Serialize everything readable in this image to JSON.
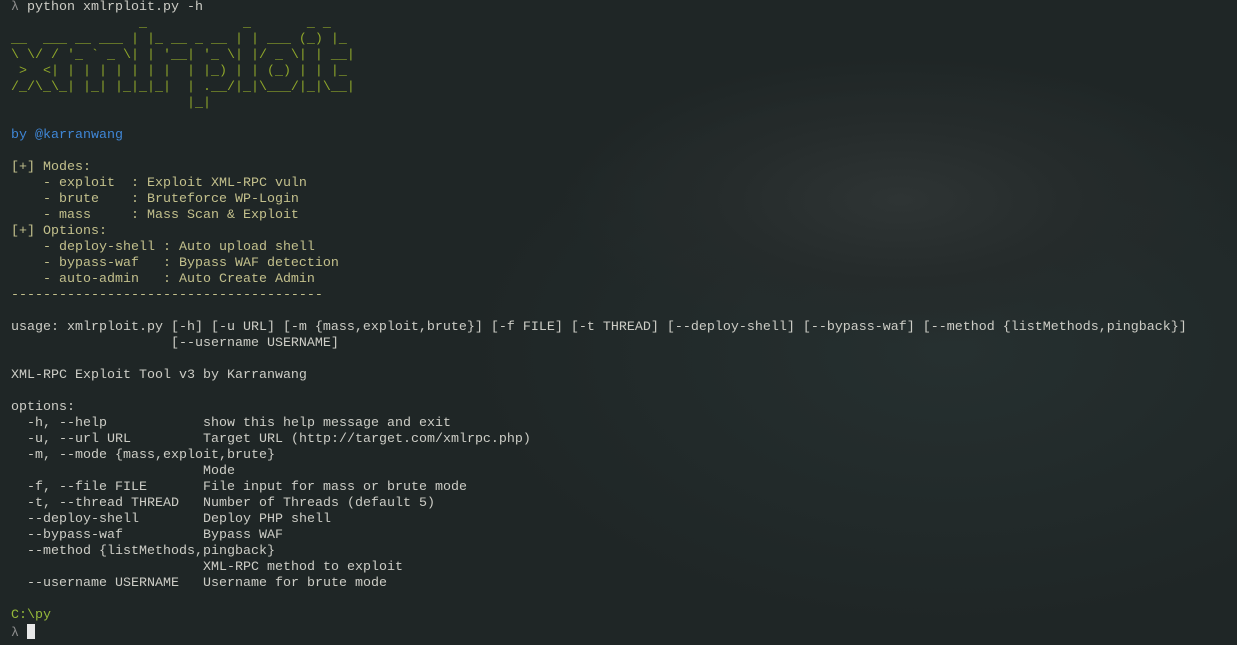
{
  "command": {
    "prompt_symbol": "λ",
    "text": "python xmlrploit.py -h"
  },
  "banner_art": [
    "                _            _       _ _   ",
    "__  ___ __ ___ | |_ __ _ __ | | ___ (_) |_ ",
    "\\ \\/ / '_ ` _ \\| | '__| '_ \\| |/ _ \\| | __|",
    " >  <| | | | | | | |  | |_) | | (_) | | |_ ",
    "/_/\\_\\_| |_| |_|_|_|  | .__/|_|\\___/|_|\\__|",
    "                      |_|                  "
  ],
  "author": "by @karranwang",
  "modes": {
    "heading": "[+] Modes:",
    "items": [
      "    - exploit  : Exploit XML-RPC vuln",
      "    - brute    : Bruteforce WP-Login",
      "    - mass     : Mass Scan & Exploit"
    ]
  },
  "options_banner": {
    "heading": "[+] Options:",
    "items": [
      "    - deploy-shell : Auto upload shell",
      "    - bypass-waf   : Bypass WAF detection",
      "    - auto-admin   : Auto Create Admin"
    ]
  },
  "separator": "---------------------------------------",
  "usage": [
    "usage: xmlrploit.py [-h] [-u URL] [-m {mass,exploit,brute}] [-f FILE] [-t THREAD] [--deploy-shell] [--bypass-waf] [--method {listMethods,pingback}]",
    "                    [--username USERNAME]"
  ],
  "description": "XML-RPC Exploit Tool v3 by Karranwang",
  "help": {
    "heading": "options:",
    "rows": [
      {
        "flag": "  -h, --help",
        "desc": "show this help message and exit"
      },
      {
        "flag": "  -u, --url URL",
        "desc": "Target URL (http://target.com/xmlrpc.php)"
      },
      {
        "flag": "  -m, --mode {mass,exploit,brute}",
        "desc": ""
      },
      {
        "flag": "",
        "desc": "Mode"
      },
      {
        "flag": "  -f, --file FILE",
        "desc": "File input for mass or brute mode"
      },
      {
        "flag": "  -t, --thread THREAD",
        "desc": "Number of Threads (default 5)"
      },
      {
        "flag": "  --deploy-shell",
        "desc": "Deploy PHP shell"
      },
      {
        "flag": "  --bypass-waf",
        "desc": "Bypass WAF"
      },
      {
        "flag": "  --method {listMethods,pingback}",
        "desc": ""
      },
      {
        "flag": "",
        "desc": "XML-RPC method to exploit"
      },
      {
        "flag": "  --username USERNAME",
        "desc": "Username for brute mode"
      }
    ]
  },
  "cwd": "C:\\py",
  "input_prompt": "λ",
  "colors": {
    "banner": "#8ea62a",
    "author": "#3f86d6",
    "menu": "#c3c08c",
    "cwd": "#95b93a",
    "text": "#cdcdc6",
    "background": "#1e2424"
  }
}
